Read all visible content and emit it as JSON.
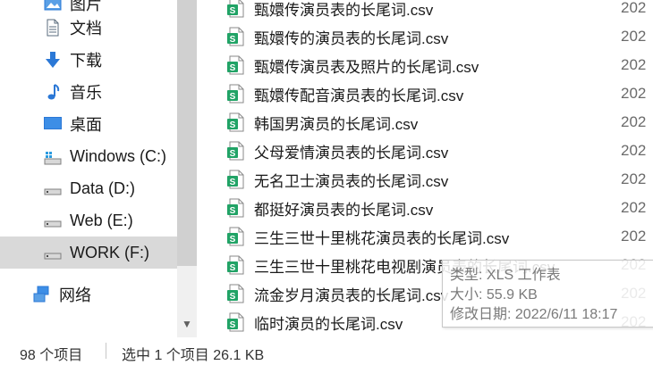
{
  "sidebar": {
    "items": [
      {
        "label": "图片",
        "icon": "pictures-icon"
      },
      {
        "label": "文档",
        "icon": "documents-icon"
      },
      {
        "label": "下载",
        "icon": "downloads-icon"
      },
      {
        "label": "音乐",
        "icon": "music-icon"
      },
      {
        "label": "桌面",
        "icon": "desktop-icon"
      },
      {
        "label": "Windows (C:)",
        "icon": "windows-drive-icon"
      },
      {
        "label": "Data (D:)",
        "icon": "drive-icon"
      },
      {
        "label": "Web (E:)",
        "icon": "drive-icon"
      },
      {
        "label": "WORK (F:)",
        "icon": "drive-icon",
        "selected": true
      },
      {
        "label": "网络",
        "icon": "network-icon"
      }
    ]
  },
  "files": [
    {
      "name": "甄嬛传演员表的长尾词.csv",
      "date": "202"
    },
    {
      "name": "甄嬛传的演员表的长尾词.csv",
      "date": "202"
    },
    {
      "name": "甄嬛传演员表及照片的长尾词.csv",
      "date": "202"
    },
    {
      "name": "甄嬛传配音演员表的长尾词.csv",
      "date": "202"
    },
    {
      "name": "韩国男演员的长尾词.csv",
      "date": "202"
    },
    {
      "name": "父母爱情演员表的长尾词.csv",
      "date": "202"
    },
    {
      "name": "无名卫士演员表的长尾词.csv",
      "date": "202"
    },
    {
      "name": "都挺好演员表的长尾词.csv",
      "date": "202"
    },
    {
      "name": "三生三世十里桃花演员表的长尾词.csv",
      "date": "202"
    },
    {
      "name": "三生三世十里桃花电视剧演员表的长尾词.csv",
      "date": "202"
    },
    {
      "name": "流金岁月演员表的长尾词.csv",
      "date": "202"
    },
    {
      "name": "临时演员的长尾词.csv",
      "date": "202"
    }
  ],
  "tooltip": {
    "type": "类型: XLS 工作表",
    "size": "大小: 55.9 KB",
    "modified": "修改日期: 2022/6/11 18:17"
  },
  "status": {
    "count": "98 个项目",
    "selection": "选中 1 个项目  26.1 KB"
  },
  "colors": {
    "csv_icon_green": "#21a366",
    "selected_bg": "#d9d9d9",
    "folder_blue": "#2b78d6"
  }
}
